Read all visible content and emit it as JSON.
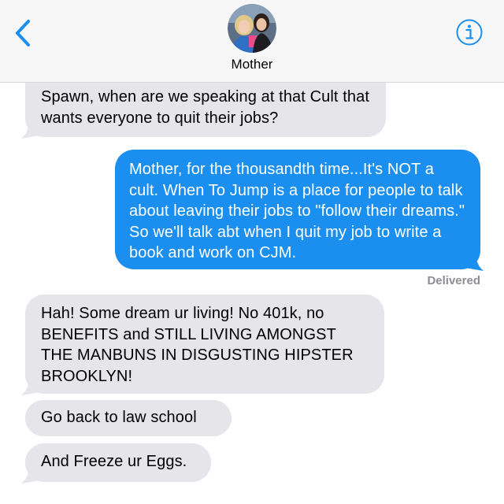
{
  "header": {
    "contact_name": "Mother",
    "back_icon": "chevron-left-icon",
    "info_icon": "info-icon",
    "accent_color": "#1b8ff0"
  },
  "messages": [
    {
      "direction": "incoming",
      "text": "Spawn, when are we speaking at that Cult that wants everyone to quit their jobs?"
    },
    {
      "direction": "outgoing",
      "text": "Mother, for the thousandth time...It's NOT a cult. When To Jump is a place for people to talk about leaving their jobs to \"follow their dreams.\" So we'll talk abt when I quit my job to write a book and work on CJM."
    },
    {
      "direction": "incoming",
      "text": "Hah! Some dream ur living! No 401k, no BENEFITS and STILL LIVING AMONGST THE MANBUNS IN DISGUSTING HIPSTER BROOKLYN!"
    },
    {
      "direction": "incoming",
      "text": "Go back to law school"
    },
    {
      "direction": "incoming",
      "text": "And Freeze ur Eggs."
    }
  ],
  "status": {
    "delivered_label": "Delivered"
  },
  "colors": {
    "incoming_bubble": "#e5e5ea",
    "outgoing_bubble": "#1b8ff0",
    "header_bg": "#f7f7f8"
  }
}
